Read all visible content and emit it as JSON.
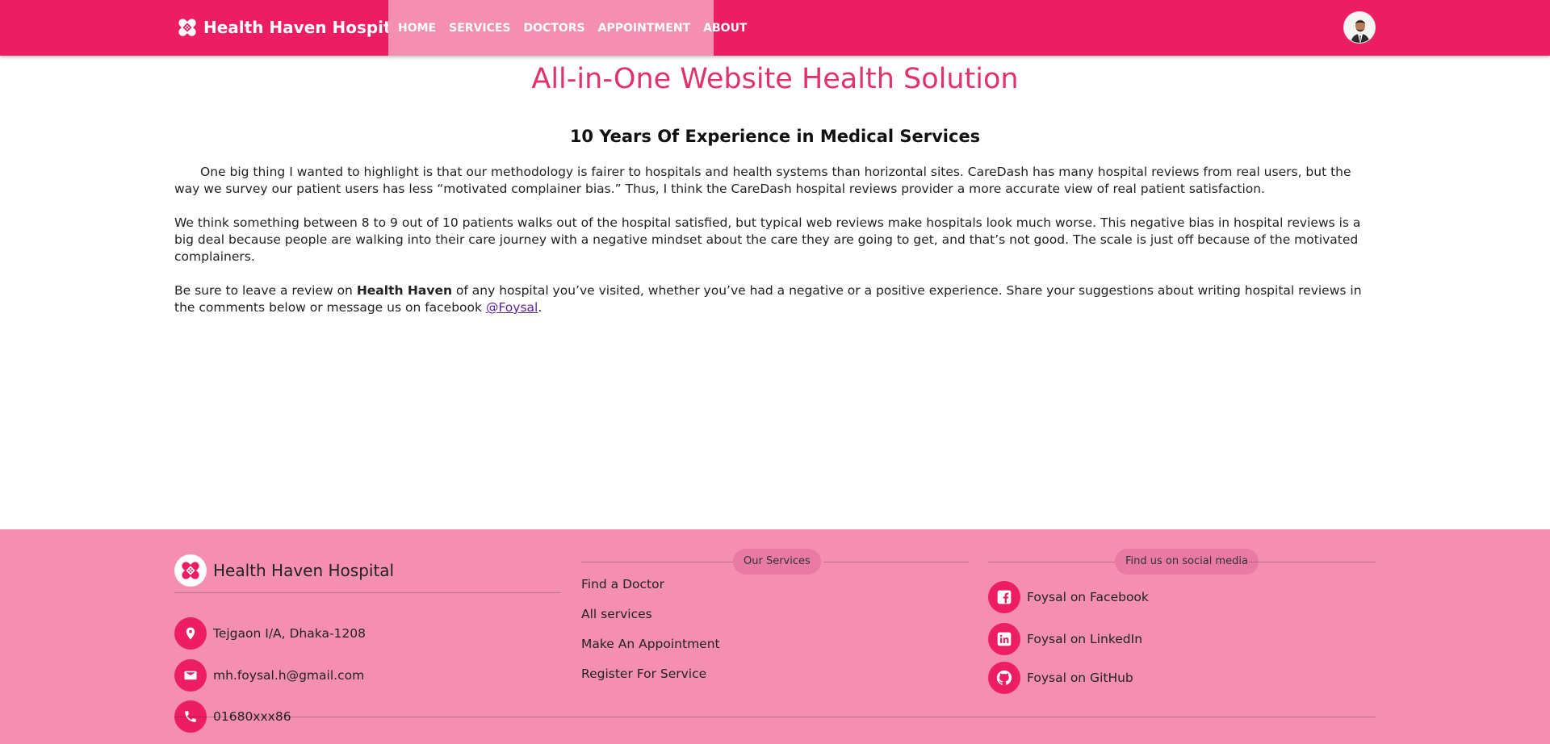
{
  "header": {
    "brand": "Health Haven Hospital",
    "nav": [
      "HOME",
      "SERVICES",
      "DOCTORS",
      "APPOINTMENT",
      "ABOUT"
    ]
  },
  "main": {
    "title": "All-in-One Website Health Solution",
    "subtitle": "10 Years Of Experience in Medical Services",
    "p1": "One big thing I wanted to highlight is that our methodology is fairer to hospitals and health systems than horizontal sites. CareDash has many hospital reviews from real users, but the way we survey our patient users has less “motivated complainer bias.” Thus, I think the CareDash hospital reviews provider a more accurate view of real patient satisfaction.",
    "p2": "We think something between 8 to 9 out of 10 patients walks out of the hospital satisfied, but typical web reviews make hospitals look much worse. This negative bias in hospital reviews is a big deal because people are walking into their care journey with a negative mindset about the care they are going to get, and that’s not good. The scale is just off because of the motivated complainers.",
    "p3_pre": "Be sure to leave a review on ",
    "p3_bold": "Health Haven",
    "p3_mid": " of any hospital you’ve visited, whether you’ve had a negative or a positive experience. Share your suggestions about writing hospital reviews in the comments below or message us on facebook ",
    "p3_link": "@Foysal",
    "p3_end": "."
  },
  "footer": {
    "brand": "Health Haven Hospital",
    "address": "Tejgaon I/A, Dhaka-1208",
    "email": "mh.foysal.h@gmail.com",
    "phone": "01680xxx86",
    "services_heading": "Our Services",
    "services": [
      "Find a Doctor",
      "All services",
      "Make An Appointment",
      "Register For Service"
    ],
    "social_heading": "Find us on social media",
    "social": [
      "Foysal on Facebook",
      "Foysal on LinkedIn",
      "Foysal on GitHub"
    ]
  },
  "colors": {
    "primary": "#ec1d63",
    "light_pink": "#f48fb1",
    "title": "#e0336a"
  },
  "icons": [
    "bandage-logo-icon",
    "location-icon",
    "email-icon",
    "phone-icon",
    "facebook-icon",
    "linkedin-icon",
    "github-icon"
  ]
}
